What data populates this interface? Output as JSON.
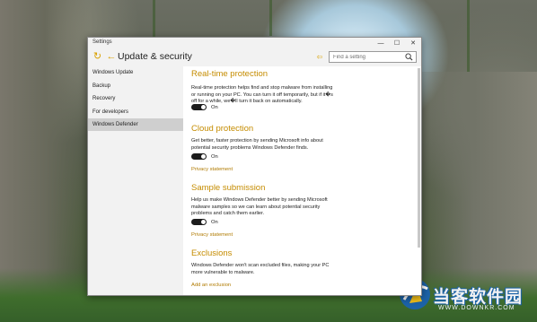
{
  "window": {
    "title": "Settings",
    "controls": {
      "minimize": "—",
      "maximize": "☐",
      "close": "✕"
    }
  },
  "header": {
    "title": "Update & security",
    "search_placeholder": "Find a setting"
  },
  "sidebar": {
    "items": [
      {
        "label": "Windows Update",
        "selected": false
      },
      {
        "label": "Backup",
        "selected": false
      },
      {
        "label": "Recovery",
        "selected": false
      },
      {
        "label": "For developers",
        "selected": false
      },
      {
        "label": "Windows Defender",
        "selected": true
      }
    ]
  },
  "main": {
    "realtime": {
      "title": "Real-time protection",
      "description": "Real-time protection helps find and stop malware from installing or running on your PC. You can turn it off temporarily, but if it�s off for a while, we�ll turn it back on automatically.",
      "toggle_state": "On"
    },
    "cloud": {
      "title": "Cloud protection",
      "description": "Get better, faster protection by sending Microsoft info about potential security problems Windows Defender finds.",
      "toggle_state": "On",
      "privacy_link": "Privacy statement"
    },
    "sample": {
      "title": "Sample submission",
      "description": "Help us make Windows Defender better by sending Microsoft malware samples so we can learn about potential security problems and catch them earlier.",
      "toggle_state": "On",
      "privacy_link": "Privacy statement"
    },
    "exclusions": {
      "title": "Exclusions",
      "description": "Windows Defender won't scan excluded files, making your PC more vulnerable to malware.",
      "add_link": "Add an exclusion"
    }
  },
  "watermark": {
    "text": "当客软件园",
    "sub": "WWW.DOWNKR.COM"
  },
  "colors": {
    "accent": "#c58c00",
    "toggle_on": "#1c1c1c",
    "sidebar_bg": "#f2f2f2",
    "selected_bg": "#cfcfcf"
  }
}
